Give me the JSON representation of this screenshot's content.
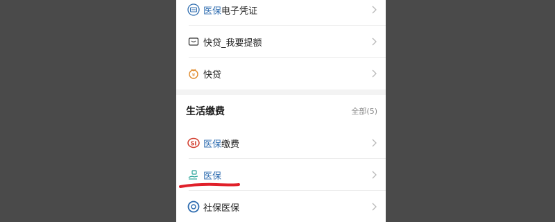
{
  "items_top": [
    {
      "highlight": "医保",
      "rest": "电子凭证",
      "icon": "medical-insurance-card-icon"
    },
    {
      "highlight": "",
      "rest": "快贷_我要提额",
      "icon": "wallet-box-icon"
    },
    {
      "highlight": "",
      "rest": "快贷",
      "icon": "coin-bag-icon"
    }
  ],
  "section": {
    "title": "生活缴费",
    "all_label": "全部(5)"
  },
  "items_bottom": [
    {
      "highlight": "医保",
      "rest": "缴费",
      "icon": "social-security-logo-icon"
    },
    {
      "highlight": "医保",
      "rest": "",
      "icon": "hand-card-icon"
    },
    {
      "highlight": "",
      "rest": "社保医保",
      "icon": "social-security-blue-icon"
    }
  ],
  "colors": {
    "background": "#4a4a4a",
    "highlight_text": "#2f6db0",
    "annotation_red": "#e0202a"
  }
}
